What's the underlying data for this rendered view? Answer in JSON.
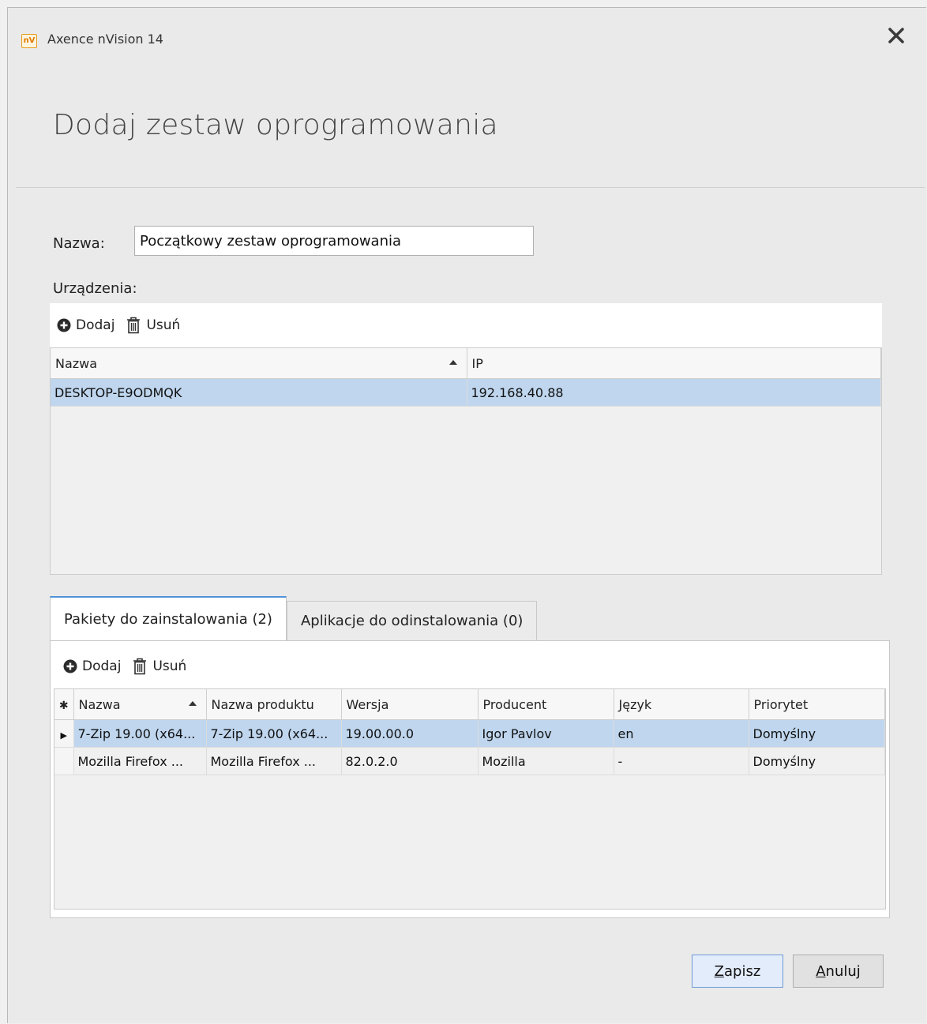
{
  "window": {
    "app_logo_text": "nV",
    "app_title": "Axence nVision 14"
  },
  "heading": "Dodaj zestaw oprogramowania",
  "form": {
    "name_label": "Nazwa:",
    "name_value": "Początkowy zestaw oprogramowania",
    "devices_label": "Urządzenia:"
  },
  "devices": {
    "toolbar": {
      "add_label": "Dodaj",
      "remove_label": "Usuń"
    },
    "columns": [
      "Nazwa",
      "IP"
    ],
    "rows": [
      {
        "name": "DESKTOP-E9ODMQK",
        "ip": "192.168.40.88"
      }
    ]
  },
  "tabs": [
    {
      "label": "Pakiety do zainstalowania (2)",
      "active": true
    },
    {
      "label": "Aplikacje do odinstalowania (0)",
      "active": false
    }
  ],
  "packages": {
    "toolbar": {
      "add_label": "Dodaj",
      "remove_label": "Usuń"
    },
    "columns": [
      "Nazwa",
      "Nazwa produktu",
      "Wersja",
      "Producent",
      "Język",
      "Priorytet"
    ],
    "rows": [
      {
        "name": "7-Zip 19.00 (x64...",
        "product": "7-Zip 19.00 (x64...",
        "version": "19.00.00.0",
        "vendor": "Igor Pavlov",
        "lang": "en",
        "priority": "Domyślny"
      },
      {
        "name": "Mozilla Firefox ...",
        "product": "Mozilla Firefox ...",
        "version": "82.0.2.0",
        "vendor": "Mozilla",
        "lang": "-",
        "priority": "Domyślny"
      }
    ]
  },
  "buttons": {
    "save_underlined": "Z",
    "save_rest": "apisz",
    "cancel_underlined": "A",
    "cancel_rest": "nuluj"
  },
  "colors": {
    "selection": "#bfd6ee",
    "accent": "#4f93d8"
  }
}
